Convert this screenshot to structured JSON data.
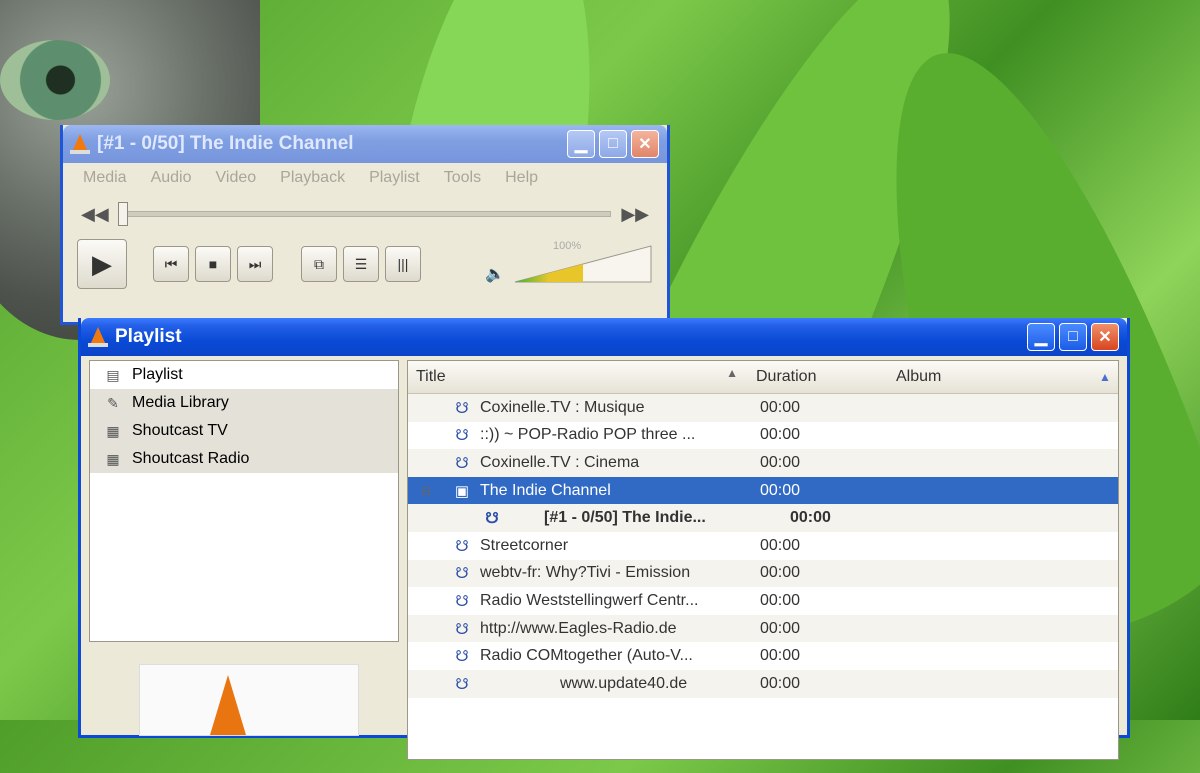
{
  "vlc": {
    "title": "[#1 - 0/50] The Indie Channel",
    "menu": [
      "Media",
      "Audio",
      "Video",
      "Playback",
      "Playlist",
      "Tools",
      "Help"
    ],
    "volume_label": "100%",
    "volume_level": 0.5
  },
  "playlist": {
    "title": "Playlist",
    "sidebar": [
      {
        "label": "Playlist",
        "icon": "playlist-icon"
      },
      {
        "label": "Media Library",
        "icon": "media-library-icon"
      },
      {
        "label": "Shoutcast TV",
        "icon": "tv-icon"
      },
      {
        "label": "Shoutcast Radio",
        "icon": "radio-icon"
      }
    ],
    "columns": {
      "title": "Title",
      "duration": "Duration",
      "album": "Album"
    },
    "rows": [
      {
        "title": "Coxinelle.TV : Musique",
        "duration": "00:00"
      },
      {
        "title": "::)) ~ POP-Radio POP three ...",
        "duration": "00:00"
      },
      {
        "title": "Coxinelle.TV : Cinema",
        "duration": "00:00"
      },
      {
        "title": "The Indie Channel",
        "duration": "00:00"
      },
      {
        "title": "[#1 - 0/50] The Indie...",
        "duration": "00:00"
      },
      {
        "title": "Streetcorner",
        "duration": "00:00"
      },
      {
        "title": "webtv-fr: Why?Tivi - Emission",
        "duration": "00:00"
      },
      {
        "title": "Radio Weststellingwerf Centr...",
        "duration": "00:00"
      },
      {
        "title": "http://www.Eagles-Radio.de",
        "duration": "00:00"
      },
      {
        "title": "Radio COMtogether (Auto-V...",
        "duration": "00:00"
      },
      {
        "title": "www.update40.de",
        "duration": "00:00"
      }
    ]
  }
}
